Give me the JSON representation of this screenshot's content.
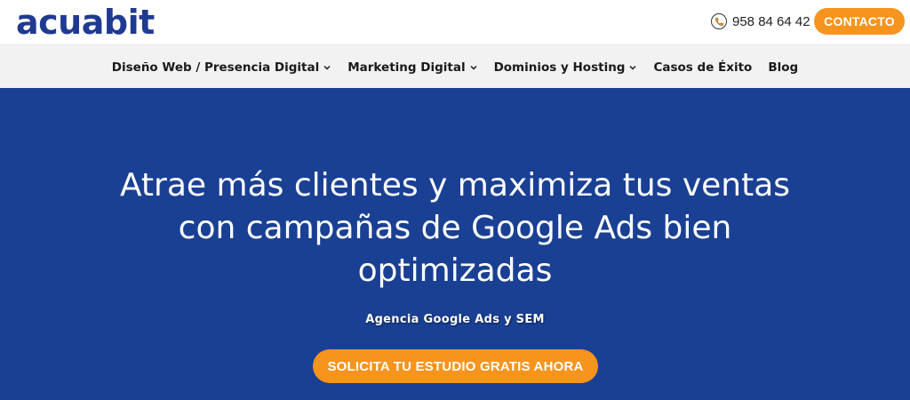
{
  "header": {
    "logo_text": "acuabit",
    "phone_icon": "phone-icon",
    "phone_number": "958 84 64 42",
    "contact_label": "CONTACTO"
  },
  "nav": {
    "items": [
      {
        "label": "Diseño Web / Presencia Digital",
        "has_dropdown": true
      },
      {
        "label": "Marketing Digital",
        "has_dropdown": true
      },
      {
        "label": "Dominios y Hosting",
        "has_dropdown": true
      },
      {
        "label": "Casos de Éxito",
        "has_dropdown": false
      },
      {
        "label": "Blog",
        "has_dropdown": false
      }
    ]
  },
  "hero": {
    "title_line1": "Atrae más clientes y maximiza tus ventas",
    "title_line2": "con campañas de Google Ads bien",
    "title_line3": "optimizadas",
    "subtitle": "Agencia Google Ads y SEM",
    "cta_label": "SOLICITA TU ESTUDIO GRATIS AHORA"
  },
  "colors": {
    "brand_blue": "#1f3a93",
    "hero_blue": "#1a4093",
    "accent_orange": "#f7941d",
    "nav_bg": "#f2f2f2"
  }
}
